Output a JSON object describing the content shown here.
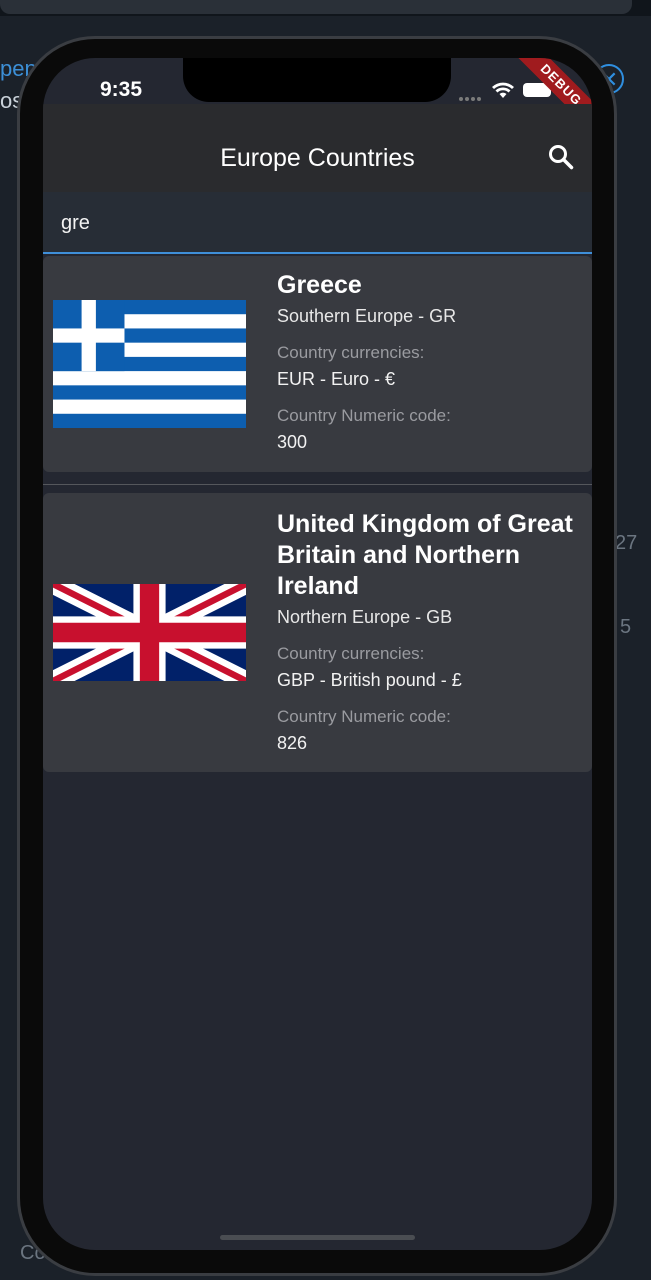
{
  "background": {
    "left_text_1": "pen",
    "left_text_2": "os:",
    "right_number_1": "27",
    "right_number_2": "5",
    "bottom_text": "Co"
  },
  "status_bar": {
    "time": "9:35",
    "debug_label": "DEBUG"
  },
  "app_bar": {
    "title": "Europe Countries",
    "search_icon": "search-icon"
  },
  "search": {
    "value": "gre",
    "accent_color": "#3f8fd9"
  },
  "countries": [
    {
      "name": "Greece",
      "region_code": "Southern Europe - GR",
      "currencies_label": "Country currencies:",
      "currencies_value": "EUR - Euro - €",
      "numeric_label": "Country Numeric code:",
      "numeric_value": "300",
      "flag_icon": "greece-flag-icon"
    },
    {
      "name": "United Kingdom of Great Britain and Northern Ireland",
      "region_code": "Northern Europe - GB",
      "currencies_label": "Country currencies:",
      "currencies_value": "GBP - British pound - £",
      "numeric_label": "Country Numeric code:",
      "numeric_value": "826",
      "flag_icon": "uk-flag-icon"
    }
  ],
  "colors": {
    "card": "#383a40",
    "screen": "#242731",
    "app_bar": "#2a2b2e",
    "debug": "#a01b1e"
  }
}
